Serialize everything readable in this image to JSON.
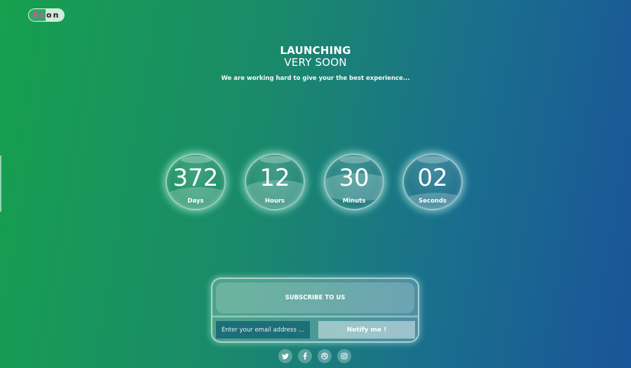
{
  "logo": {
    "text": "Soon"
  },
  "hero": {
    "title_line1": "LAUNCHING",
    "title_line2": "VERY SOON",
    "tagline": "We are working hard to give your the best experience..."
  },
  "countdown": [
    {
      "value": "372",
      "label": "Days"
    },
    {
      "value": "12",
      "label": "Hours"
    },
    {
      "value": "30",
      "label": "Minuts"
    },
    {
      "value": "02",
      "label": "Seconds"
    }
  ],
  "subscribe": {
    "heading": "SUBSCRIBE TO US",
    "email_placeholder": "Enter your email address ...",
    "email_value": "",
    "button_label": "Notify me !"
  },
  "social": [
    {
      "icon": "twitter-icon"
    },
    {
      "icon": "facebook-icon"
    },
    {
      "icon": "dribbble-icon"
    },
    {
      "icon": "instagram-icon"
    }
  ],
  "colors": {
    "gradient_start": "#16a04e",
    "gradient_end": "#1a5499",
    "text": "#ffffff",
    "input_bg": "#1d6e78"
  }
}
